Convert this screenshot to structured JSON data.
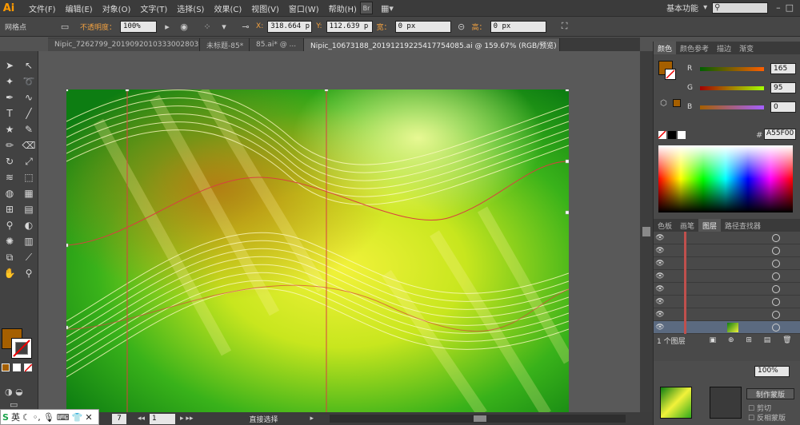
{
  "app": {
    "logo": "Ai",
    "workspace": "基本功能",
    "search_placeholder": ""
  },
  "menu": [
    "文件(F)",
    "编辑(E)",
    "对象(O)",
    "文字(T)",
    "选择(S)",
    "效果(C)",
    "视图(V)",
    "窗口(W)",
    "帮助(H)"
  ],
  "control": {
    "mode_label": "网格点",
    "opacity_label": "不透明度：",
    "opacity_value": "100%",
    "x_label": "X:",
    "x_value": "318.664 p",
    "y_label": "Y:",
    "y_value": "112.639 p",
    "w_label": "宽：",
    "w_value": "0 px",
    "h_label": "高：",
    "h_value": "0 px"
  },
  "tabs": [
    {
      "label": "Nipic_7262799_20190920103330028031.ai*"
    },
    {
      "label": "未标题-85*"
    },
    {
      "label": "85.ai* @ ..."
    },
    {
      "label": "Nipic_10673188_20191219225417754085.ai @ 159.67% (RGB/预览)"
    }
  ],
  "colors": {
    "fill": "#A55F00",
    "accent": "#ff9a00"
  },
  "color_panel": {
    "tabs": [
      "颜色",
      "颜色参考",
      "描边",
      "渐变"
    ],
    "r_label": "R",
    "r_value": "165",
    "g_label": "G",
    "g_value": "95",
    "b_label": "B",
    "b_value": "0",
    "hex_label": "#",
    "hex_value": "A55F00"
  },
  "layers_panel": {
    "tabs": [
      "色板",
      "画笔",
      "图层",
      "路径查找器"
    ],
    "count_label": "1 个图层",
    "rows": 8,
    "opacity_value": "100%",
    "mask_button": "制作蒙版",
    "clip_label": "剪切",
    "invert_label": "反相蒙版"
  },
  "status": {
    "zoom": "7",
    "page": "1",
    "tool": "直接选择"
  },
  "ime": {
    "label": "英"
  }
}
